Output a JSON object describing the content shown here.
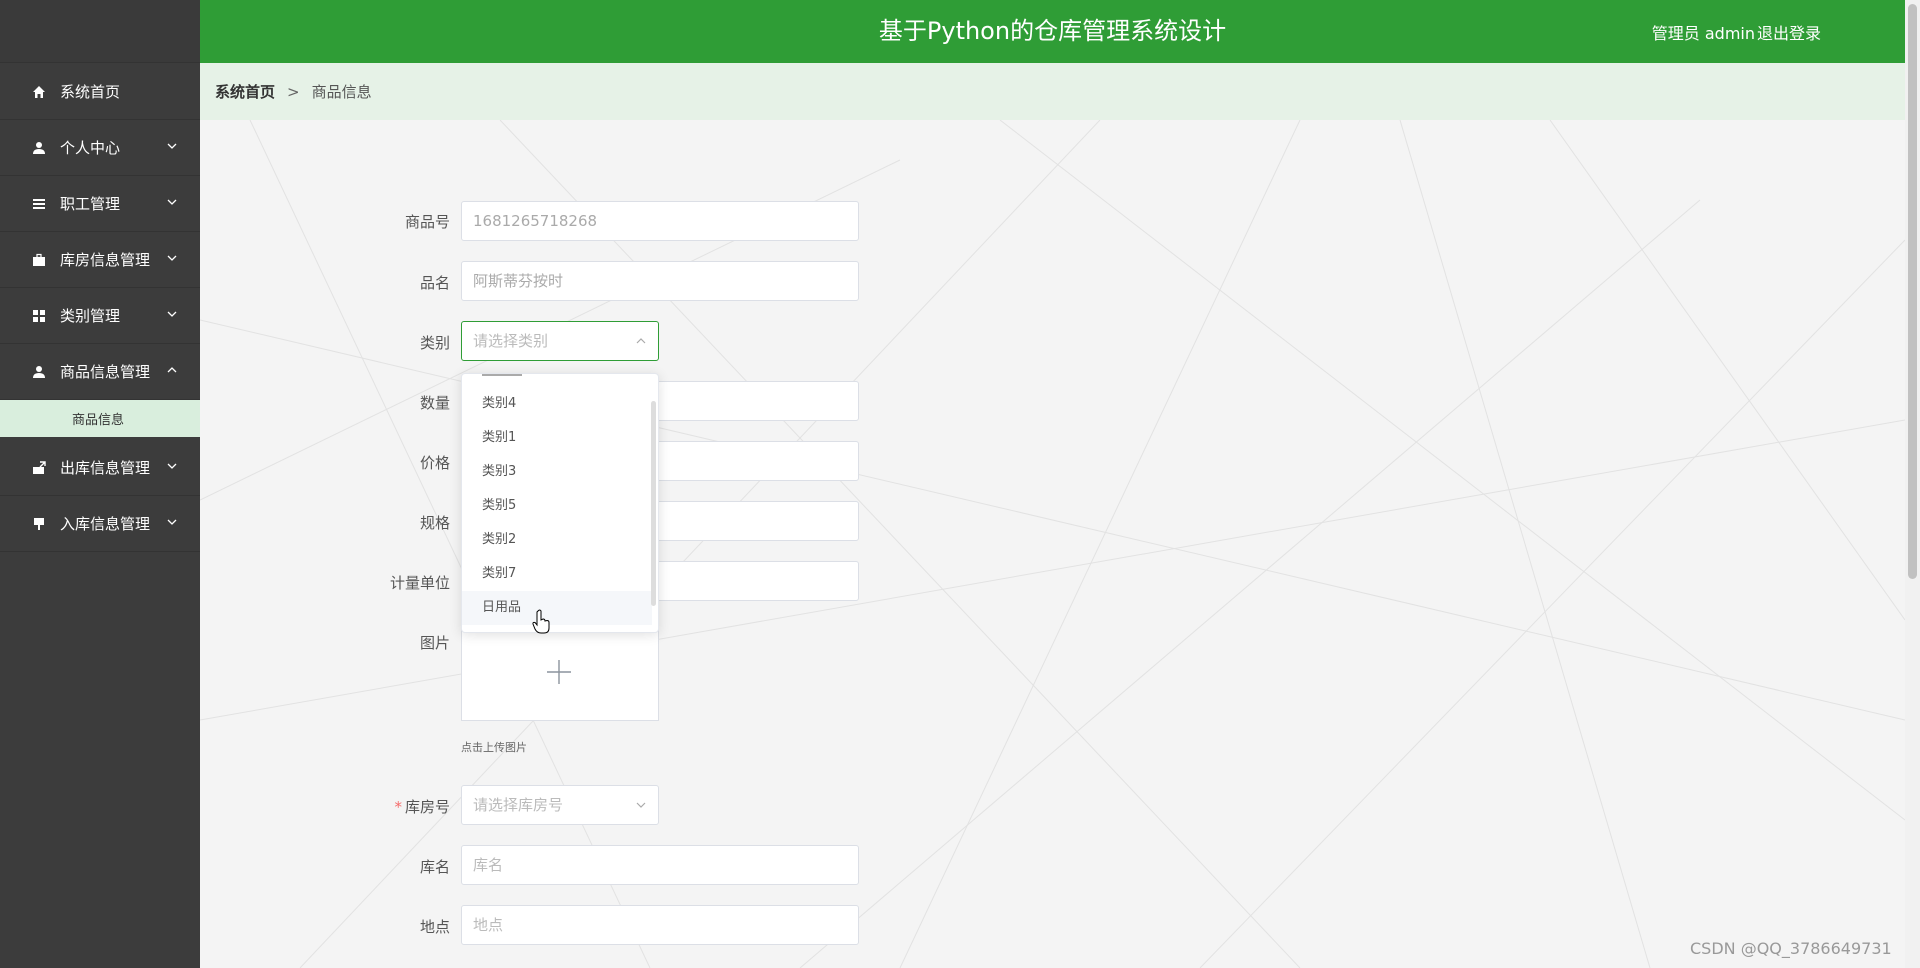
{
  "app_title": "基于Python的仓库管理系统设计",
  "header": {
    "user_text": "管理员 admin",
    "logout_label": "退出登录"
  },
  "sidebar": {
    "items": [
      {
        "label": "系统首页",
        "icon": "home-icon"
      },
      {
        "label": "个人中心",
        "icon": "user-icon"
      },
      {
        "label": "职工管理",
        "icon": "list-icon"
      },
      {
        "label": "库房信息管理",
        "icon": "briefcase-icon"
      },
      {
        "label": "类别管理",
        "icon": "grid-icon"
      },
      {
        "label": "商品信息管理",
        "icon": "user-icon"
      },
      {
        "label": "出库信息管理",
        "icon": "box-out-icon"
      },
      {
        "label": "入库信息管理",
        "icon": "stamp-icon"
      }
    ],
    "submenu": {
      "label": "商品信息"
    }
  },
  "breadcrumb": {
    "home": "系统首页",
    "separator": ">",
    "current": "商品信息"
  },
  "form": {
    "product_no": {
      "label": "商品号",
      "value": "1681265718268"
    },
    "name": {
      "label": "品名",
      "value": "阿斯蒂芬按时"
    },
    "category": {
      "label": "类别",
      "placeholder": "请选择类别"
    },
    "quantity": {
      "label": "数量"
    },
    "price": {
      "label": "价格"
    },
    "spec": {
      "label": "规格"
    },
    "unit": {
      "label": "计量单位"
    },
    "image": {
      "label": "图片",
      "hint": "点击上传图片"
    },
    "warehouse_no": {
      "label": "库房号",
      "placeholder": "请选择库房号",
      "required_mark": "*"
    },
    "warehouse_name": {
      "label": "库名",
      "placeholder": "库名"
    },
    "location": {
      "label": "地点",
      "placeholder": "地点"
    }
  },
  "category_dropdown": {
    "options": [
      "类别4",
      "类别1",
      "类别3",
      "类别5",
      "类别2",
      "类别7",
      "日用品"
    ],
    "hovered": "日用品"
  },
  "watermark": "CSDN @QQ_3786649731",
  "colors": {
    "header": "#2f9d36",
    "sidebar": "#3c3c3c",
    "submenu": "#d9eedd",
    "breadcrumb": "#e6f2e7"
  }
}
